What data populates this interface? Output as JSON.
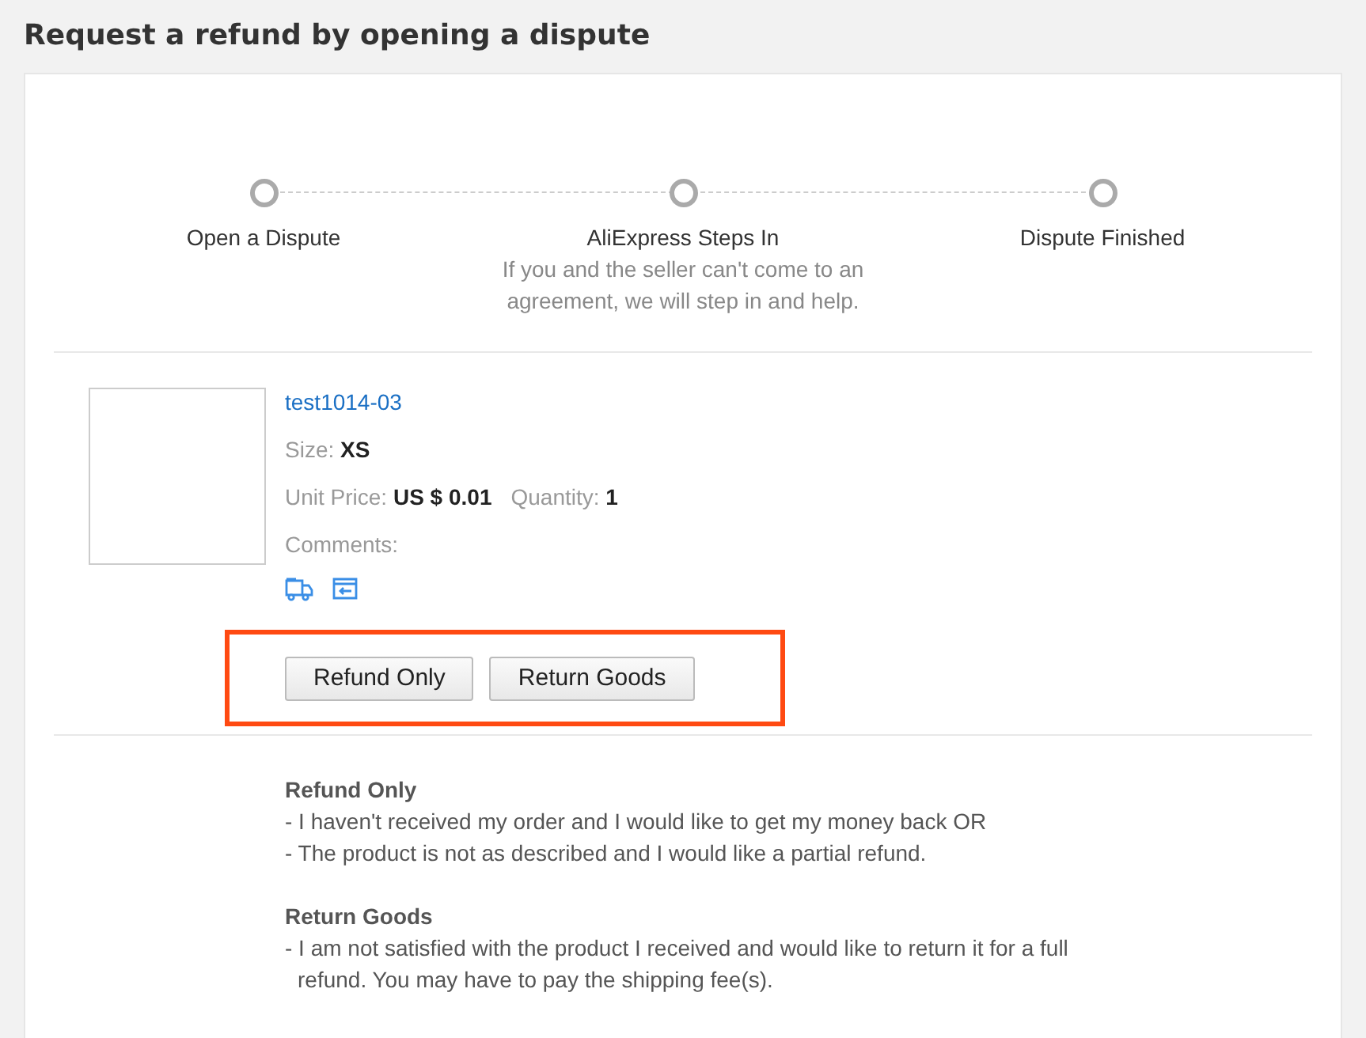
{
  "page_title": "Request a refund by opening a dispute",
  "steps": [
    {
      "label": "Open a Dispute"
    },
    {
      "label": "AliExpress Steps In",
      "description": "If you and the seller can't come to an agreement, we will step in and help."
    },
    {
      "label": "Dispute Finished"
    }
  ],
  "product": {
    "name": "test1014-03",
    "size_label": "Size:",
    "size": "XS",
    "price_label": "Unit Price:",
    "price": "US $ 0.01",
    "quantity_label": "Quantity:",
    "quantity": "1",
    "comments_label": "Comments:"
  },
  "actions": [
    {
      "label": "Refund Only"
    },
    {
      "label": "Return Goods"
    }
  ],
  "explanations": [
    {
      "title": "Refund Only",
      "lines": [
        "- I haven't received my order and I would like to get my money back OR",
        "- The product is not as described and I would like a partial refund."
      ]
    },
    {
      "title": "Return Goods",
      "lines": [
        "- I am not satisfied with the product I received and would like to return it for a full refund. You may have to pay the shipping fee(s)."
      ]
    }
  ]
}
